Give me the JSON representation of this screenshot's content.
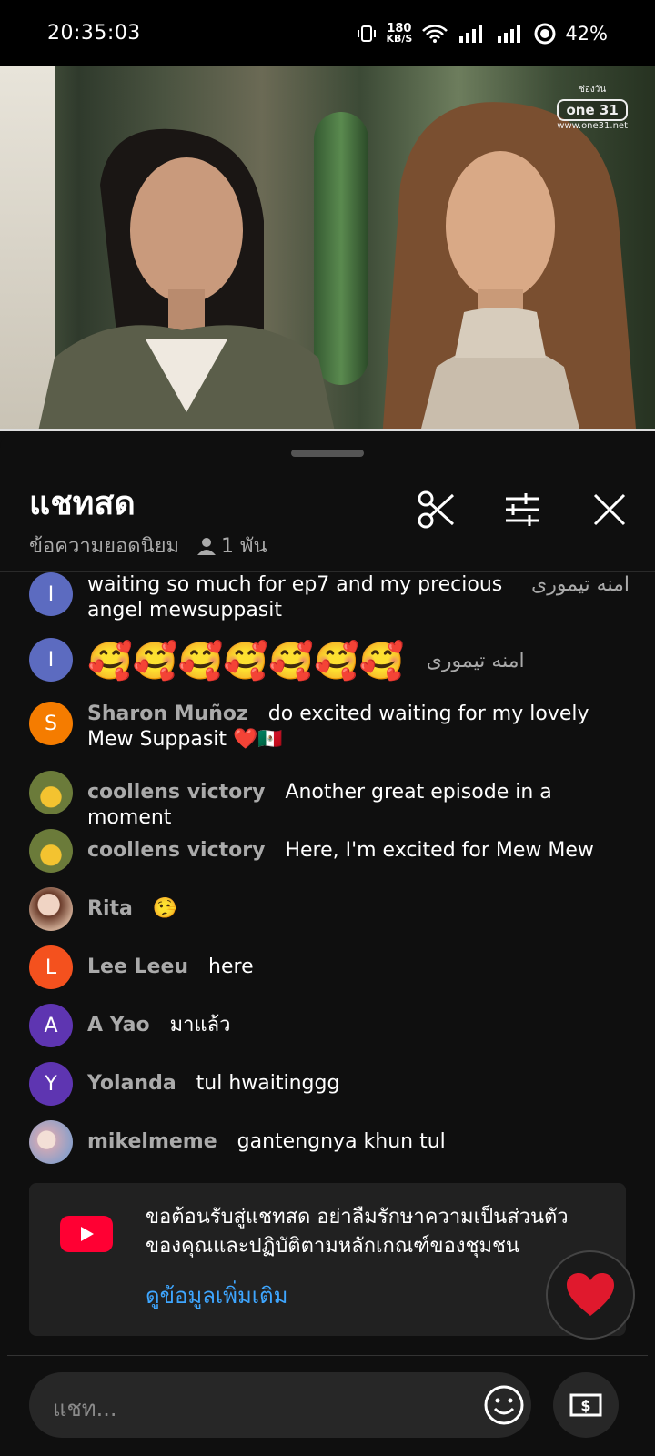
{
  "status_bar": {
    "time": "20:35:03",
    "net_speed_value": "180",
    "net_speed_unit": "KB/S",
    "battery": "42%"
  },
  "video": {
    "channel_logo_top": "ช่องวัน",
    "channel_logo_main": "one 31",
    "channel_logo_url": "www.one31.net"
  },
  "chat": {
    "title": "แชทสด",
    "mode": "ข้อความยอดนิยม",
    "viewers": "1 พัน",
    "messages": [
      {
        "author": "امنه تیموری",
        "initial": "I",
        "text": "waiting so much for ep7 and my precious angel mewsuppasit",
        "avatar_color": "#5c6bc0"
      },
      {
        "author": "امنه تیموری",
        "initial": "I",
        "text": "🥰🥰🥰🥰🥰🥰🥰",
        "avatar_color": "#5c6bc0"
      },
      {
        "author": "Sharon Muñoz",
        "initial": "S",
        "text": "do excited waiting for my lovely Mew Suppasit ❤️🇲🇽",
        "avatar_color": "#f57c00"
      },
      {
        "author": "coollens victory",
        "initial": "",
        "text": "Another great episode in a moment",
        "avatar_color": "#6b7b3a"
      },
      {
        "author": "coollens victory",
        "initial": "",
        "text": "Here, I'm excited for Mew Mew",
        "avatar_color": "#6b7b3a"
      },
      {
        "author": "Rita",
        "initial": "",
        "text": "🤥",
        "avatar_color": "#c9a58e"
      },
      {
        "author": "Lee Leeu",
        "initial": "L",
        "text": "here",
        "avatar_color": "#f4511e"
      },
      {
        "author": "A Yao",
        "initial": "A",
        "text": "มาแล้ว",
        "avatar_color": "#5e35b1"
      },
      {
        "author": "Yolanda",
        "initial": "Y",
        "text": "tul hwaitinggg",
        "avatar_color": "#5e35b1"
      },
      {
        "author": "mikelmeme",
        "initial": "",
        "text": "gantengnya khun tul",
        "avatar_color": "#c8a8b8"
      }
    ],
    "welcome_text": "ขอต้อนรับสู่แชทสด อย่าลืมรักษาความเป็นส่วนตัวของคุณและปฏิบัติตามหลักเกณฑ์ของชุมชน",
    "learn_more": "ดูข้อมูลเพิ่มเติม",
    "input_placeholder": "แชท..."
  },
  "colors": {
    "background": "#0f0f0f",
    "link": "#3ea6ff",
    "youtube_red": "#ff0033"
  }
}
